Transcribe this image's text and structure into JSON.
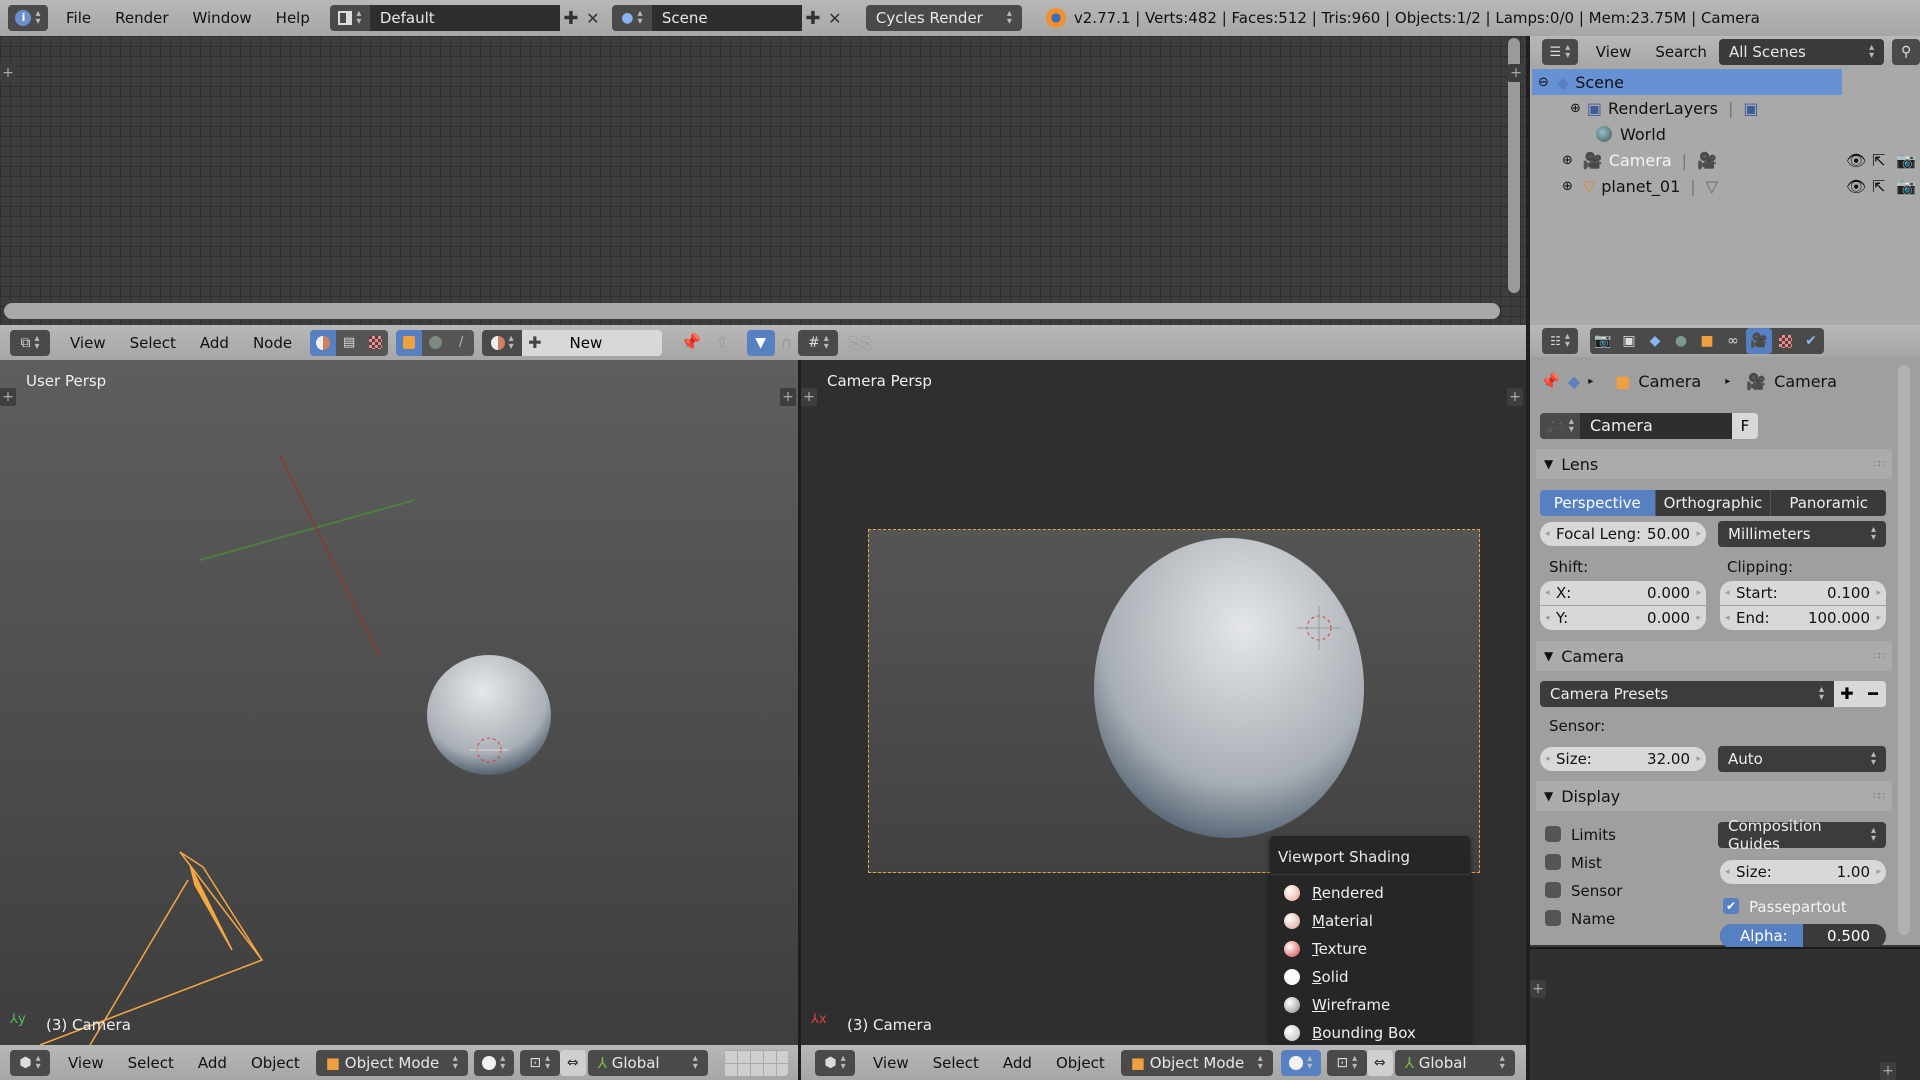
{
  "topbar": {
    "menus": [
      "File",
      "Render",
      "Window",
      "Help"
    ],
    "screen_layout": "Default",
    "scene": "Scene",
    "render_engine": "Cycles Render",
    "stats": "v2.77.1 | Verts:482 | Faces:512 | Tris:960 | Objects:1/2 | Lamps:0/0 | Mem:23.75M | Camera"
  },
  "outliner": {
    "menus": [
      "View",
      "Search"
    ],
    "filter": "All Scenes",
    "items": [
      {
        "label": "Scene",
        "icon": "scene-icon",
        "selected": true
      },
      {
        "label": "RenderLayers",
        "icon": "render-layers-icon"
      },
      {
        "label": "World",
        "icon": "world-icon"
      },
      {
        "label": "Camera",
        "icon": "camera-object-icon",
        "active": true
      },
      {
        "label": "planet_01",
        "icon": "mesh-object-icon"
      }
    ]
  },
  "node_editor": {
    "menus": [
      "View",
      "Select",
      "Add",
      "Node"
    ],
    "new_label": "New"
  },
  "viewport_left": {
    "label": "User Persp",
    "object_info": "(3) Camera",
    "menus": [
      "View",
      "Select",
      "Add",
      "Object"
    ],
    "mode": "Object Mode",
    "orientation": "Global"
  },
  "viewport_right": {
    "label": "Camera Persp",
    "object_info": "(3) Camera",
    "menus": [
      "View",
      "Select",
      "Add",
      "Object"
    ],
    "mode": "Object Mode",
    "orientation": "Global"
  },
  "shading_menu": {
    "title": "Viewport Shading",
    "items": [
      {
        "label": "Rendered",
        "key": "R",
        "rest": "endered",
        "color": "#e8a08a"
      },
      {
        "label": "Material",
        "key": "M",
        "rest": "aterial",
        "color": "#d8a090"
      },
      {
        "label": "Texture",
        "key": "T",
        "rest": "exture",
        "color": "#d44040"
      },
      {
        "label": "Solid",
        "key": "S",
        "rest": "olid",
        "color": "#f2f2f2"
      },
      {
        "label": "Wireframe",
        "key": "W",
        "rest": "ireframe",
        "color": "#888888"
      },
      {
        "label": "Bounding Box",
        "key": "B",
        "rest": "ounding Box",
        "color": "#bbbbbb"
      }
    ]
  },
  "properties": {
    "breadcrumb": [
      "Camera",
      "Camera"
    ],
    "datablock": "Camera",
    "fake_user": "F",
    "lens": {
      "title": "Lens",
      "types": [
        "Perspective",
        "Orthographic",
        "Panoramic"
      ],
      "active_type": "Perspective",
      "focal_label": "Focal Leng:",
      "focal_value": "50.00",
      "units": "Millimeters",
      "shift_label": "Shift:",
      "shift_x_label": "X:",
      "shift_x": "0.000",
      "shift_y_label": "Y:",
      "shift_y": "0.000",
      "clipping_label": "Clipping:",
      "clip_start_label": "Start:",
      "clip_start": "0.100",
      "clip_end_label": "End:",
      "clip_end": "100.000"
    },
    "camera": {
      "title": "Camera",
      "presets": "Camera Presets",
      "sensor_label": "Sensor:",
      "size_label": "Size:",
      "size_value": "32.00",
      "fit": "Auto"
    },
    "display": {
      "title": "Display",
      "checks": [
        "Limits",
        "Mist",
        "Sensor",
        "Name"
      ],
      "guides": "Composition Guides",
      "size_label": "Size:",
      "size_value": "1.00",
      "passepartout": "Passepartout",
      "alpha_label": "Alpha:",
      "alpha_value": "0.500",
      "alpha_fraction": 0.5
    }
  },
  "colors": {
    "accent": "#5680c2",
    "selection": "#f5a742"
  }
}
